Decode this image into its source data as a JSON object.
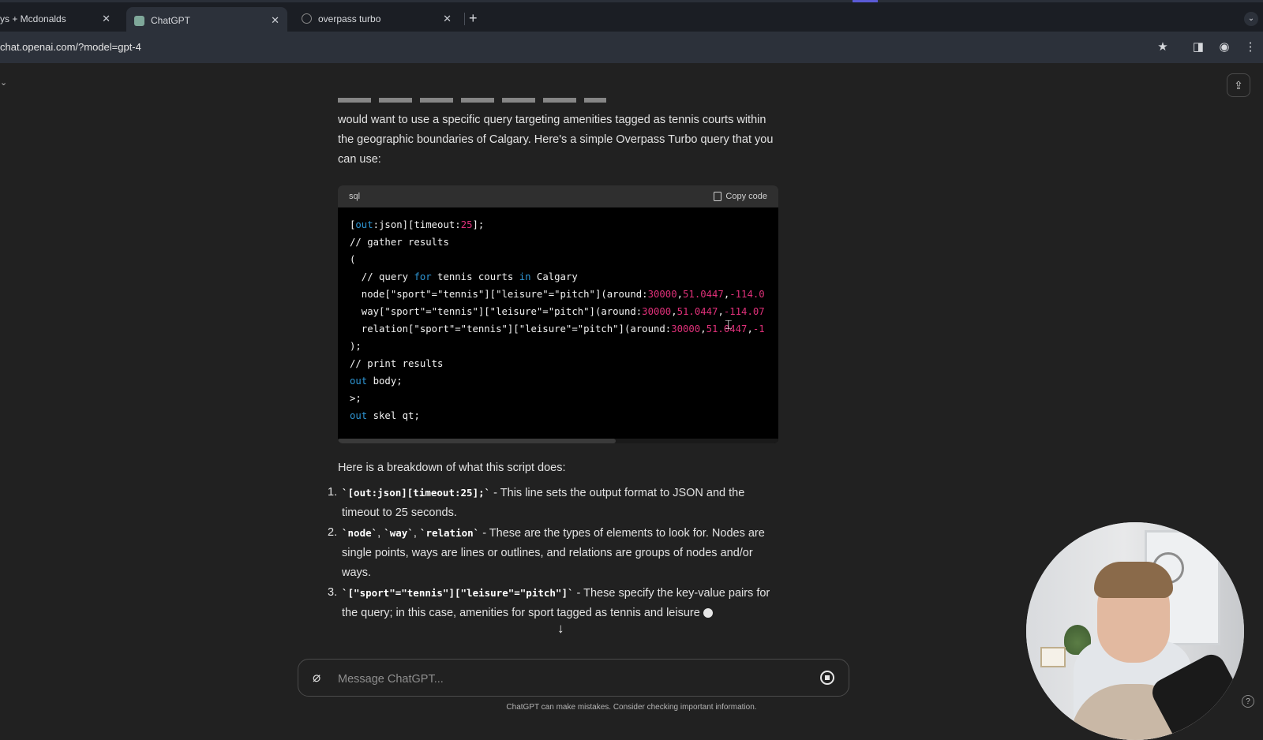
{
  "browser": {
    "tabs": [
      {
        "title": "ys + Mcdonalds",
        "active": false
      },
      {
        "title": "ChatGPT",
        "active": true
      },
      {
        "title": "overpass turbo",
        "active": false
      }
    ],
    "url": "chat.openai.com/?model=gpt-4"
  },
  "chat": {
    "intro": "would want to use a specific query targeting amenities tagged as tennis courts within the geographic boundaries of Calgary. Here's a simple Overpass Turbo query that you can use:",
    "code_language": "sql",
    "copy_label": "Copy code",
    "code": {
      "l1": {
        "a": "[",
        "b": "out",
        "c": ":json][timeout:",
        "d": "25",
        "e": "];"
      },
      "l2": "// gather results",
      "l3": "(",
      "l4": {
        "a": "  // query ",
        "b": "for",
        "c": " tennis courts ",
        "d": "in",
        "e": " Calgary"
      },
      "l5": {
        "a": "  node[\"sport\"=\"tennis\"][\"leisure\"=\"pitch\"](around:",
        "b": "30000",
        "c": ",",
        "d": "51.0447",
        "e": ",",
        "f": "-114.0"
      },
      "l6": {
        "a": "  way[\"sport\"=\"tennis\"][\"leisure\"=\"pitch\"](around:",
        "b": "30000",
        "c": ",",
        "d": "51.0447",
        "e": ",",
        "f": "-114.07"
      },
      "l7": {
        "a": "  relation[\"sport\"=\"tennis\"][\"leisure\"=\"pitch\"](around:",
        "b": "30000",
        "c": ",",
        "d": "51.0447",
        "e": ",",
        "f": "-1"
      },
      "l8": ");",
      "l9": "// print results",
      "l10": {
        "a": "out",
        "b": " body;"
      },
      "l11": ">;",
      "l12": {
        "a": "out",
        "b": " skel qt;"
      }
    },
    "breakdown_intro": "Here is a breakdown of what this script does:",
    "items": [
      {
        "num": "1.",
        "code": "`[out:json][timeout:25];`",
        "text": " - This line sets the output format to JSON and the timeout to 25 seconds."
      },
      {
        "num": "2.",
        "code1": "`node`",
        "sep1": ", ",
        "code2": "`way`",
        "sep2": ", ",
        "code3": "`relation`",
        "text": " - These are the types of elements to look for. Nodes are single points, ways are lines or outlines, and relations are groups of nodes and/or ways."
      },
      {
        "num": "3.",
        "code": "`[\"sport\"=\"tennis\"][\"leisure\"=\"pitch\"]`",
        "text": " - These specify the key-value pairs for the query; in this case, amenities for sport tagged as tennis and leisure"
      }
    ]
  },
  "composer": {
    "placeholder": "Message ChatGPT...",
    "disclaimer": "ChatGPT can make mistakes. Consider checking important information."
  },
  "help": "?"
}
